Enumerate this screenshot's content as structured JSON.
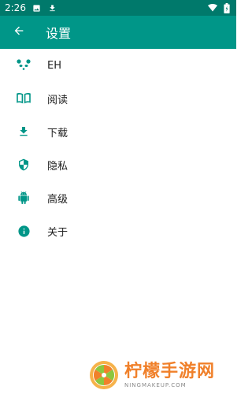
{
  "status_bar": {
    "time": "2:26",
    "left_icons": [
      "image-icon",
      "download-icon"
    ],
    "right_icons": [
      "wifi-icon",
      "battery-icon"
    ]
  },
  "app_bar": {
    "back_icon": "arrow-left-icon",
    "title": "设置"
  },
  "menu": {
    "items": [
      {
        "label": "EH",
        "icon": "panda-icon"
      },
      {
        "label": "阅读",
        "icon": "book-icon"
      },
      {
        "label": "下载",
        "icon": "download-icon"
      },
      {
        "label": "隐私",
        "icon": "shield-icon"
      },
      {
        "label": "高级",
        "icon": "android-icon"
      },
      {
        "label": "关于",
        "icon": "info-icon"
      }
    ]
  },
  "watermark": {
    "name": "柠檬手游网",
    "url": "NINGMAKEUP.COM"
  },
  "colors": {
    "status_bar": "#00796b",
    "app_bar": "#009688",
    "icon": "#009688",
    "watermark_text": "#f0802a"
  }
}
